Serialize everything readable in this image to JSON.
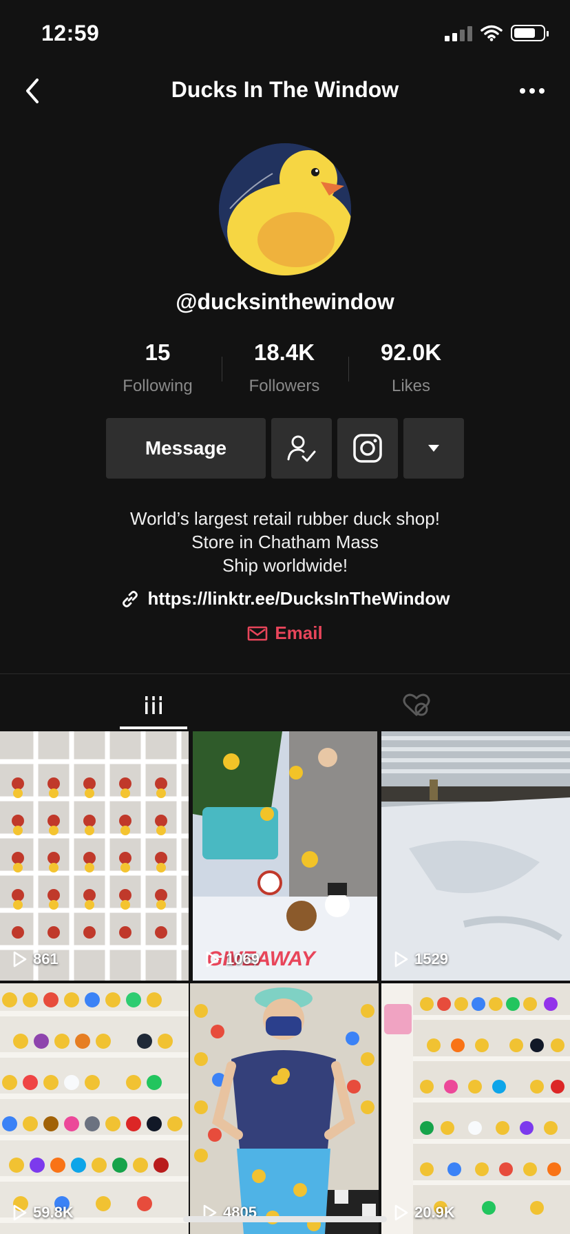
{
  "status": {
    "time": "12:59"
  },
  "header": {
    "title": "Ducks In The Window"
  },
  "profile": {
    "handle": "@ducksinthewindow",
    "stats": [
      {
        "value": "15",
        "label": "Following"
      },
      {
        "value": "18.4K",
        "label": "Followers"
      },
      {
        "value": "92.0K",
        "label": "Likes"
      }
    ],
    "message_label": "Message",
    "bio": [
      "World’s largest retail rubber duck shop!",
      "Store in Chatham Mass",
      "Ship worldwide!"
    ],
    "link": "https://linktr.ee/DucksInTheWindow",
    "email_label": "Email"
  },
  "colors": {
    "background": "#121212",
    "button": "#2f2f2f",
    "accent": "#e8455a",
    "duck_yellow": "#f6d643",
    "avatar_bg": "#21325e"
  },
  "tabs": {
    "videos_icon": "grid-icon",
    "liked_icon": "liked-hidden-icon"
  },
  "videos": [
    {
      "views": "861",
      "overlay": ""
    },
    {
      "views": "1069",
      "overlay": "GIVEAWAY"
    },
    {
      "views": "1529",
      "overlay": ""
    },
    {
      "views": "59.8K",
      "overlay": ""
    },
    {
      "views": "4805",
      "overlay": ""
    },
    {
      "views": "20.9K",
      "overlay": ""
    }
  ]
}
